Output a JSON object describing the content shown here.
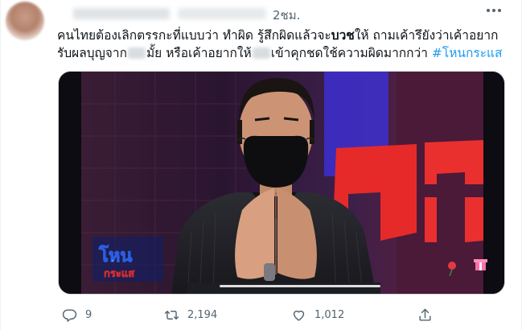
{
  "tweet": {
    "timestamp": "2ชม.",
    "text": {
      "line1_a": "คนไทยต้องเลิกตรรกะที่แบบว่า ทำผิด รู้สึกผิดแล้วจะ",
      "line1_bold": "บวช",
      "line1_b": "ให้ ถามเค้ารึยังว่าเค้าอยาก",
      "line2_a": "รับผลบุญจาก",
      "line2_b": "มั้ย หรือเค้าอยากให้",
      "line2_c": "เข้าคุกชดใช้ความผิดมากกว่า",
      "hashtag": "#โหนกระแส"
    },
    "media": {
      "logo_line1": "โหน",
      "logo_line2": "กระแส",
      "backdrop_text": "กระ"
    },
    "actions": {
      "reply_count": "9",
      "retweet_count": "2,194",
      "like_count": "1,012"
    },
    "colors": {
      "link": "#1d9bf0",
      "muted": "#536471"
    },
    "icons": [
      "more-icon",
      "reply-icon",
      "retweet-icon",
      "like-icon",
      "share-icon"
    ]
  }
}
